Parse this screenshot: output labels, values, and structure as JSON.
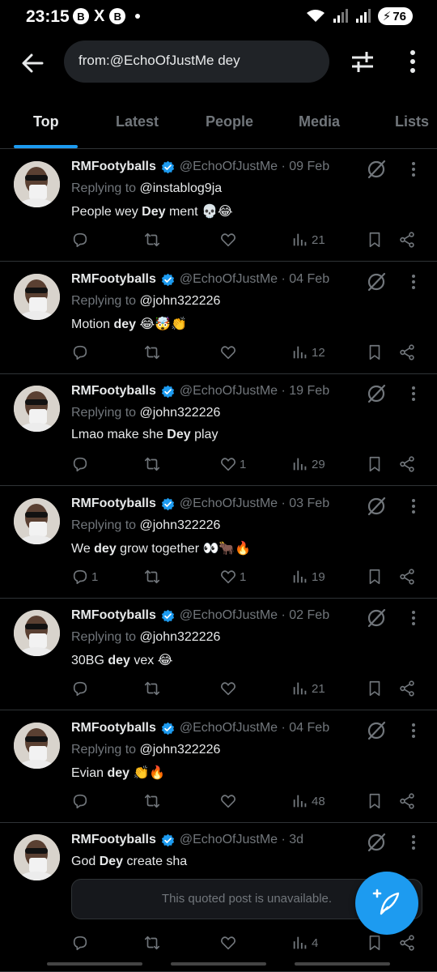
{
  "status": {
    "time": "23:15",
    "badge1": "B",
    "badge2": "B",
    "x_label": "X",
    "battery": "76"
  },
  "search": {
    "query": "from:@EchoOfJustMe dey"
  },
  "tabs": [
    {
      "label": "Top"
    },
    {
      "label": "Latest"
    },
    {
      "label": "People"
    },
    {
      "label": "Media"
    },
    {
      "label": "Lists"
    }
  ],
  "tweets": [
    {
      "name": "RMFootyballs",
      "handle": "@EchoOfJustMe",
      "date": "09 Feb",
      "replying_prefix": "Replying to",
      "replying_to": "@instablog9ja",
      "text_before": "People wey ",
      "text_bold": "Dey",
      "text_after": " ment 💀😂",
      "replies": "",
      "likes": "",
      "views": "21"
    },
    {
      "name": "RMFootyballs",
      "handle": "@EchoOfJustMe",
      "date": "04 Feb",
      "replying_prefix": "Replying to",
      "replying_to": "@john322226",
      "text_before": "Motion ",
      "text_bold": "dey",
      "text_after": " 😂🤯👏",
      "replies": "",
      "likes": "",
      "views": "12"
    },
    {
      "name": "RMFootyballs",
      "handle": "@EchoOfJustMe",
      "date": "19 Feb",
      "replying_prefix": "Replying to",
      "replying_to": "@john322226",
      "text_before": "Lmao make she ",
      "text_bold": "Dey",
      "text_after": " play",
      "replies": "",
      "likes": "1",
      "views": "29"
    },
    {
      "name": "RMFootyballs",
      "handle": "@EchoOfJustMe",
      "date": "03 Feb",
      "replying_prefix": "Replying to",
      "replying_to": "@john322226",
      "text_before": "We ",
      "text_bold": "dey",
      "text_after": " grow together 👀🐂🔥",
      "replies": "1",
      "likes": "1",
      "views": "19"
    },
    {
      "name": "RMFootyballs",
      "handle": "@EchoOfJustMe",
      "date": "02 Feb",
      "replying_prefix": "Replying to",
      "replying_to": "@john322226",
      "text_before": "30BG ",
      "text_bold": "dey",
      "text_after": " vex 😂",
      "replies": "",
      "likes": "",
      "views": "21"
    },
    {
      "name": "RMFootyballs",
      "handle": "@EchoOfJustMe",
      "date": "04 Feb",
      "replying_prefix": "Replying to",
      "replying_to": "@john322226",
      "text_before": "Evian ",
      "text_bold": "dey",
      "text_after": " 👏🔥",
      "replies": "",
      "likes": "",
      "views": "48"
    }
  ],
  "last_tweet": {
    "name": "RMFootyballs",
    "handle": "@EchoOfJustMe",
    "date": "3d",
    "text_before": "God ",
    "text_bold": "Dey",
    "text_after": " create sha",
    "quoted_unavailable": "This quoted post is unavailable.",
    "views": "4"
  },
  "separator": "·",
  "colors": {
    "background": "#000000",
    "accent": "#1d9bf0",
    "muted": "#71767b",
    "text": "#e7e9ea",
    "divider": "#2f3336"
  }
}
